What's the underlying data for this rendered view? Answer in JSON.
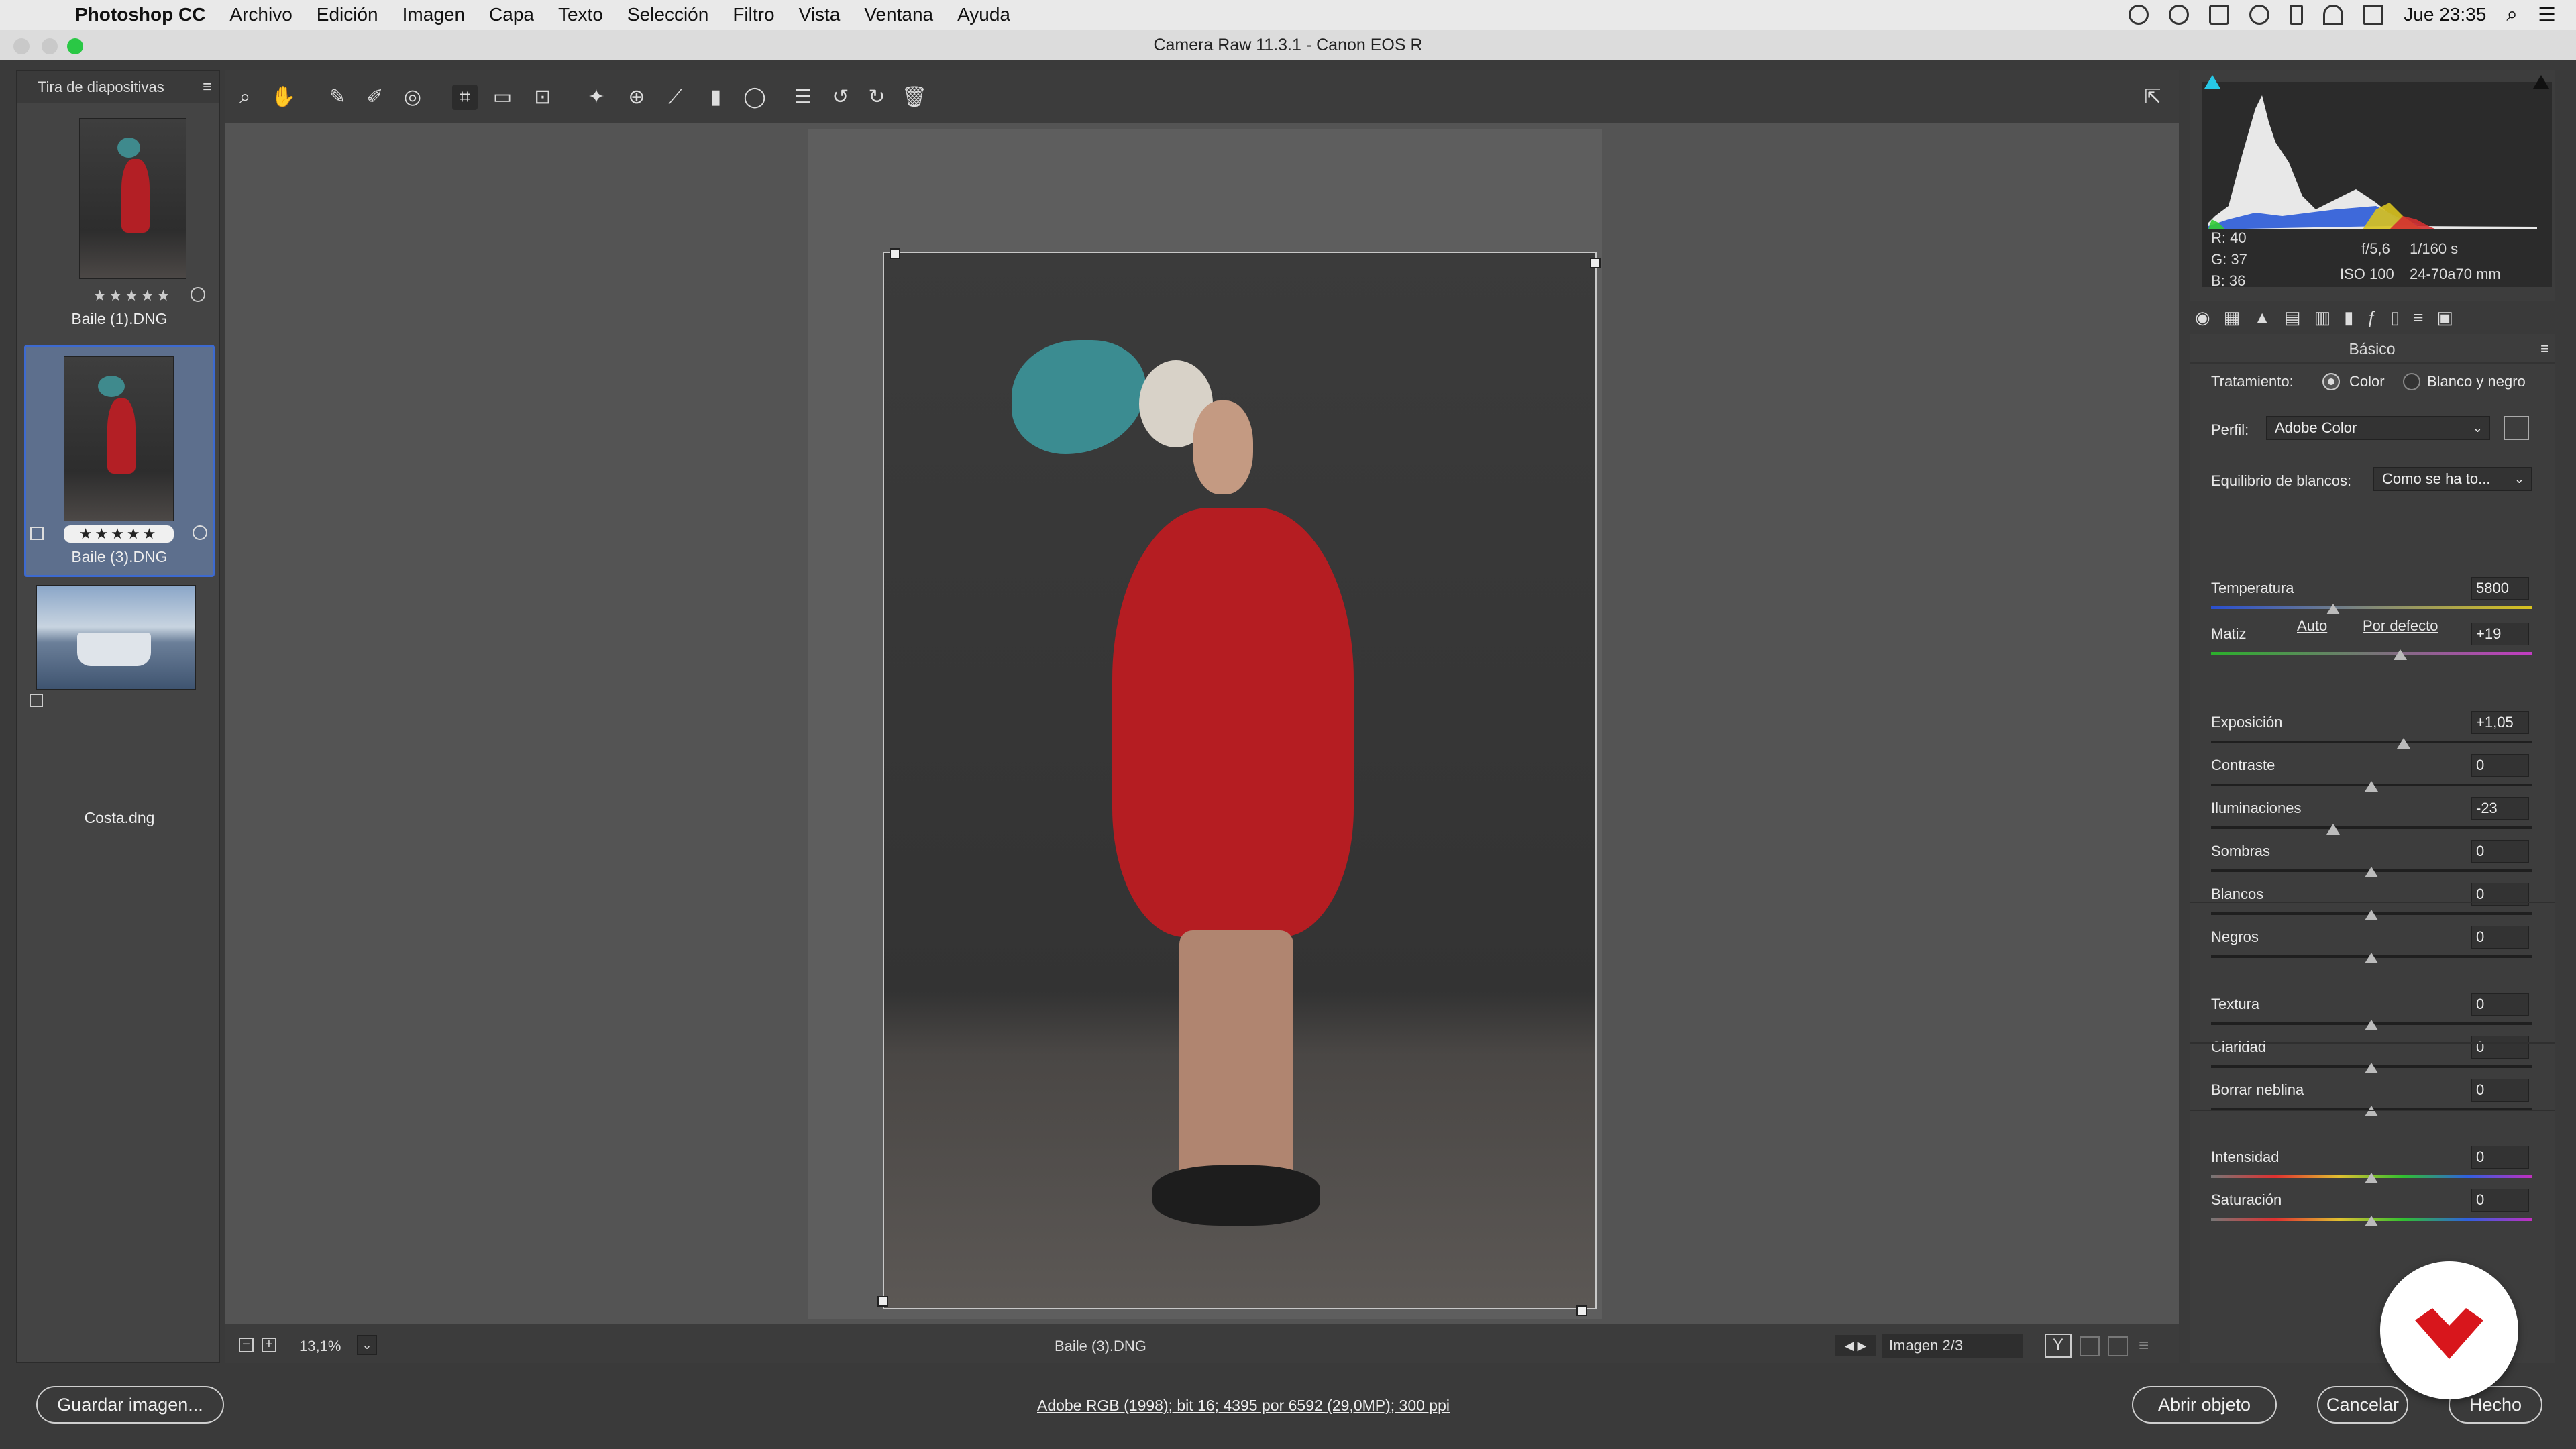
{
  "menubar": {
    "app": "Photoshop CC",
    "items": [
      "Archivo",
      "Edición",
      "Imagen",
      "Capa",
      "Texto",
      "Selección",
      "Filtro",
      "Vista",
      "Ventana",
      "Ayuda"
    ],
    "clock": "Jue 23:35"
  },
  "window": {
    "title": "Camera Raw 11.3.1 -  Canon EOS R"
  },
  "filmstrip": {
    "title": "Tira de diapositivas",
    "items": [
      {
        "name": "Baile (1).DNG",
        "stars": "★★★★★"
      },
      {
        "name": "Baile (3).DNG",
        "stars": "★★★★★"
      },
      {
        "name": "Costa.dng",
        "stars": ""
      }
    ]
  },
  "toolbar": {
    "tools": [
      "zoom-icon",
      "hand-icon",
      "white-balance-icon",
      "color-sampler-icon",
      "target-adjust-icon",
      "crop-icon",
      "straighten-icon",
      "transform-icon",
      "spot-removal-icon",
      "red-eye-icon",
      "adjustment-brush-icon",
      "graduated-filter-icon",
      "radial-filter-icon",
      "preferences-icon",
      "rotate-left-icon",
      "rotate-right-icon",
      "trash-icon"
    ]
  },
  "statusbar": {
    "zoom": "13,1%",
    "filename": "Baile (3).DNG",
    "image_counter": "Imagen 2/3"
  },
  "panel": {
    "readout": {
      "r": "R:  40",
      "g": "G:  37",
      "b": "B:  36",
      "aperture": "f/5,6",
      "shutter": "1/160 s",
      "iso": "ISO 100",
      "lens": "24-70a70 mm"
    },
    "section_title": "Básico",
    "treatment_label": "Tratamiento:",
    "treatment_color": "Color",
    "treatment_bw": "Blanco y negro",
    "profile_label": "Perfil:",
    "profile_value": "Adobe Color",
    "wb_label": "Equilibrio de blancos:",
    "wb_value": "Como se ha to...",
    "auto": "Auto",
    "default": "Por defecto",
    "sliders": [
      {
        "label": "Temperatura",
        "value": "5800",
        "pos": 0.38
      },
      {
        "label": "Matiz",
        "value": "+19",
        "pos": 0.59
      },
      {
        "label": "Exposición",
        "value": "+1,05",
        "pos": 0.6
      },
      {
        "label": "Contraste",
        "value": "0",
        "pos": 0.5
      },
      {
        "label": "Iluminaciones",
        "value": "-23",
        "pos": 0.38
      },
      {
        "label": "Sombras",
        "value": "0",
        "pos": 0.5
      },
      {
        "label": "Blancos",
        "value": "0",
        "pos": 0.5
      },
      {
        "label": "Negros",
        "value": "0",
        "pos": 0.5
      },
      {
        "label": "Textura",
        "value": "0",
        "pos": 0.5
      },
      {
        "label": "Claridad",
        "value": "0",
        "pos": 0.5
      },
      {
        "label": "Borrar neblina",
        "value": "0",
        "pos": 0.5
      },
      {
        "label": "Intensidad",
        "value": "0",
        "pos": 0.5
      },
      {
        "label": "Saturación",
        "value": "0",
        "pos": 0.5
      }
    ]
  },
  "footer": {
    "save": "Guardar imagen...",
    "info": "Adobe RGB (1998); bit 16; 4395 por 6592 (29,0MP); 300 ppi",
    "open": "Abrir objeto",
    "cancel": "Cancelar",
    "done": "Hecho"
  }
}
